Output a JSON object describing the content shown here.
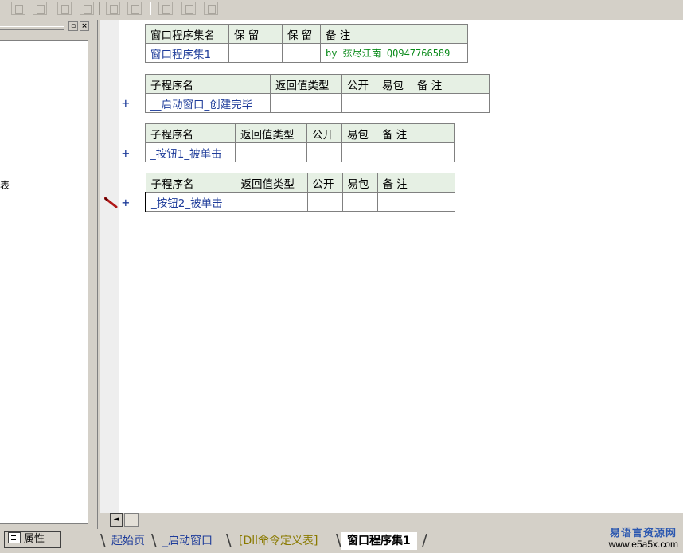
{
  "left_pane": {
    "fragment_text": "表",
    "min_button": "▫",
    "close_button": "×",
    "bottom_tab_label": "属性"
  },
  "toolbar": {
    "icons": [
      "align-left-icon",
      "align-center-icon",
      "align-top-icon",
      "align-right-icon",
      "equal-width-icon",
      "equal-height-icon",
      "same-width-icon",
      "same-height-icon",
      "center-icon"
    ]
  },
  "assembly_table": {
    "headers": [
      "窗口程序集名",
      "保 留",
      "保 留",
      "备 注"
    ],
    "row": [
      "窗口程序集1",
      "",
      "",
      "by 弦尽江南 QQ947766589"
    ]
  },
  "subs": [
    {
      "headers": [
        "子程序名",
        "返回值类型",
        "公开",
        "易包",
        "备 注"
      ],
      "row": [
        "__启动窗口_创建完毕",
        "",
        "",
        "",
        ""
      ]
    },
    {
      "headers": [
        "子程序名",
        "返回值类型",
        "公开",
        "易包",
        "备 注"
      ],
      "row": [
        "_按钮1_被单击",
        "",
        "",
        "",
        ""
      ]
    },
    {
      "headers": [
        "子程序名",
        "返回值类型",
        "公开",
        "易包",
        "备 注"
      ],
      "row": [
        "_按钮2_被单击",
        "",
        "",
        "",
        ""
      ]
    }
  ],
  "expand_symbol": "+",
  "scroll_left": "◄",
  "tabs": [
    "起始页",
    "_启动窗口",
    "[Dll命令定义表]",
    "窗口程序集1"
  ],
  "watermark": {
    "title": "易语言资源网",
    "url": "www.e5a5x.com"
  }
}
